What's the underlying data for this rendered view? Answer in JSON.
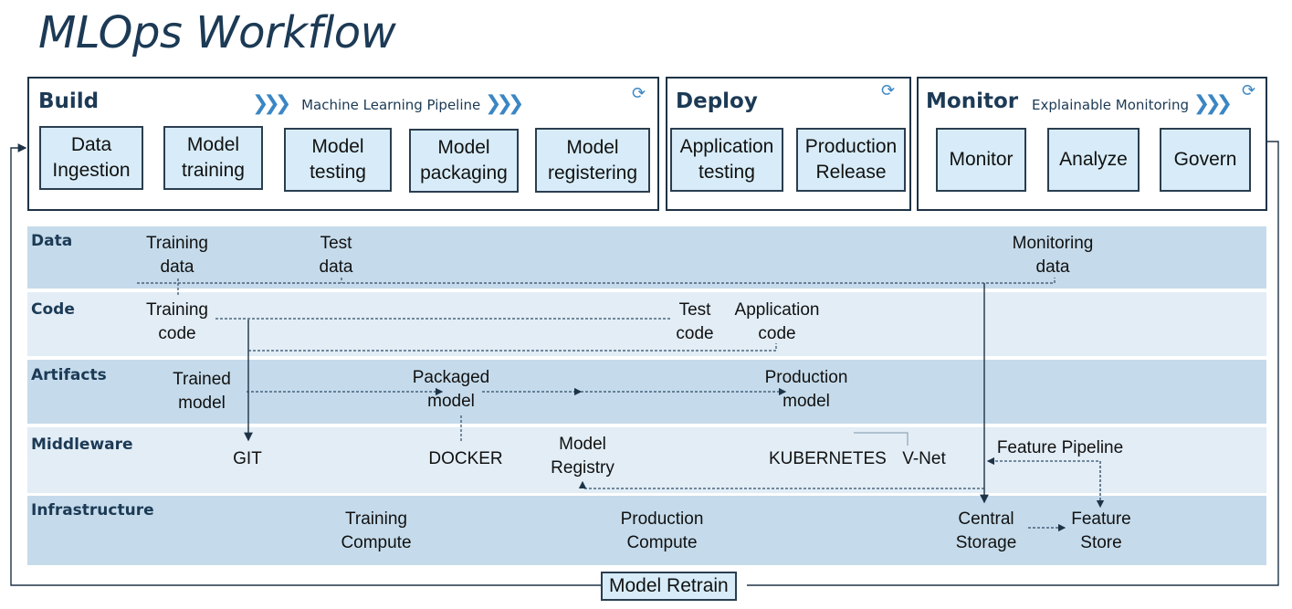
{
  "title": "MLOps Workflow",
  "build": {
    "title": "Build",
    "pipeline_label": "Machine Learning Pipeline",
    "steps": [
      "Data\nIngestion",
      "Model\ntraining",
      "Model\ntesting",
      "Model\npackaging",
      "Model\nregistering"
    ]
  },
  "deploy": {
    "title": "Deploy",
    "steps": [
      "Application\ntesting",
      "Production\nRelease"
    ]
  },
  "monitor": {
    "title": "Monitor",
    "pipeline_label": "Explainable Monitoring",
    "steps": [
      "Monitor",
      "Analyze",
      "Govern"
    ]
  },
  "layers": {
    "data": {
      "label": "Data",
      "items": [
        "Training\ndata",
        "Test\ndata",
        "Monitoring\ndata"
      ]
    },
    "code": {
      "label": "Code",
      "items": [
        "Training\ncode",
        "Test\ncode",
        "Application\ncode"
      ]
    },
    "artifacts": {
      "label": "Artifacts",
      "items": [
        "Trained\nmodel",
        "Packaged\nmodel",
        "Production\nmodel"
      ]
    },
    "middleware": {
      "label": "Middleware",
      "items": [
        "GIT",
        "DOCKER",
        "Model\nRegistry",
        "KUBERNETES",
        "V-Net",
        "Feature Pipeline"
      ]
    },
    "infrastructure": {
      "label": "Infrastructure",
      "items": [
        "Training\nCompute",
        "Production\nCompute",
        "Central\nStorage",
        "Feature\nStore"
      ]
    }
  },
  "retrain_label": "Model Retrain",
  "colors": {
    "accent": "#3b86c4",
    "box_fill": "#d7ecf8",
    "dark_band": "#c5dbeb",
    "light_band": "#e2edf6",
    "navy": "#1c3a55"
  }
}
